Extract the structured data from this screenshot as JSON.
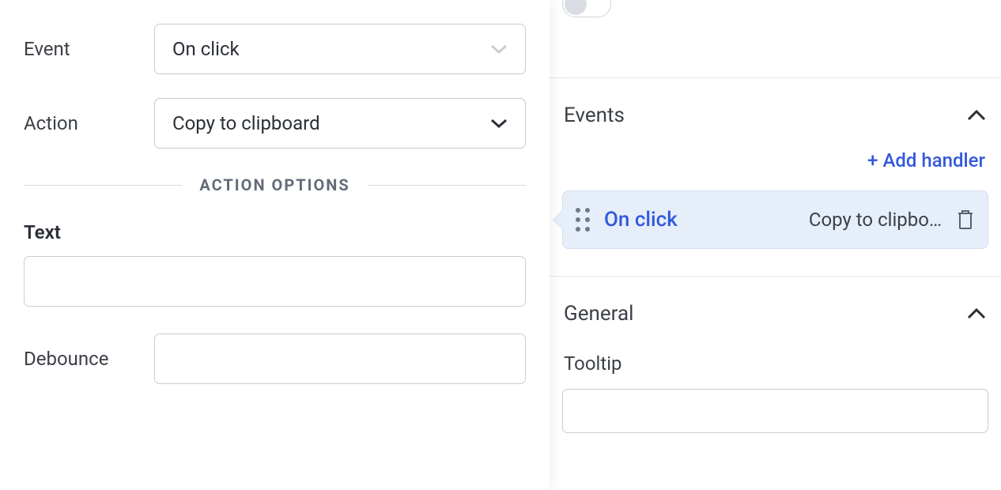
{
  "leftPanel": {
    "eventLabel": "Event",
    "eventValue": "On click",
    "actionLabel": "Action",
    "actionValue": "Copy to clipboard",
    "actionOptionsLabel": "ACTION OPTIONS",
    "textLabel": "Text",
    "textValue": "",
    "debounceLabel": "Debounce",
    "debounceValue": ""
  },
  "rightPanel": {
    "toggleOn": false,
    "eventsSection": {
      "title": "Events",
      "addHandlerLabel": "+ Add handler",
      "handler": {
        "event": "On click",
        "action": "Copy to clipbo…"
      }
    },
    "generalSection": {
      "title": "General",
      "tooltipLabel": "Tooltip",
      "tooltipValue": ""
    }
  }
}
